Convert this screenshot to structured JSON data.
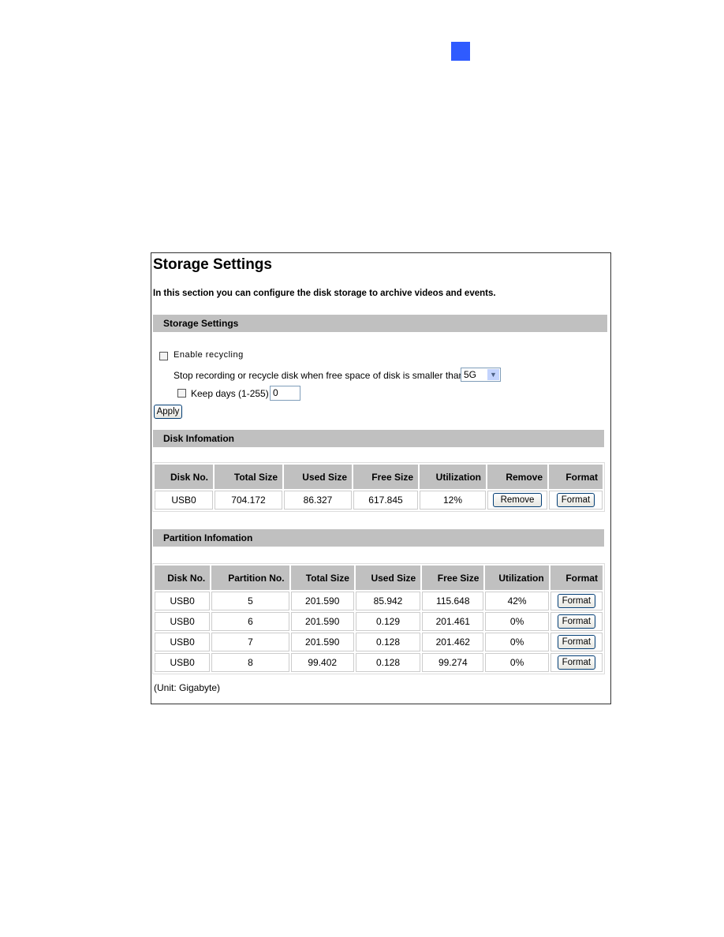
{
  "page_marker_color": "#2f5bff",
  "title": "Storage Settings",
  "intro": "In this section you can configure the disk storage to archive videos and events.",
  "storage": {
    "section_title": "Storage Settings",
    "enable_recycling": {
      "label": "Enable recycling",
      "checked": false
    },
    "threshold_label": "Stop recording or recycle disk when free space of disk is smaller than",
    "threshold_value": "5G",
    "keep_days": {
      "label": "Keep days (1-255)",
      "checked": false,
      "value": "0"
    },
    "apply_label": "Apply"
  },
  "disk": {
    "section_title": "Disk Infomation",
    "headers": [
      "Disk No.",
      "Total Size",
      "Used Size",
      "Free Size",
      "Utilization",
      "Remove",
      "Format"
    ],
    "rows": [
      [
        "USB0",
        "704.172",
        "86.327",
        "617.845",
        "12%",
        "Remove",
        "Format"
      ]
    ]
  },
  "partition": {
    "section_title": "Partition Infomation",
    "headers": [
      "Disk No.",
      "Partition No.",
      "Total Size",
      "Used Size",
      "Free Size",
      "Utilization",
      "Format"
    ],
    "rows": [
      [
        "USB0",
        "5",
        "201.590",
        "85.942",
        "115.648",
        "42%",
        "Format"
      ],
      [
        "USB0",
        "6",
        "201.590",
        "0.129",
        "201.461",
        "0%",
        "Format"
      ],
      [
        "USB0",
        "7",
        "201.590",
        "0.128",
        "201.462",
        "0%",
        "Format"
      ],
      [
        "USB0",
        "8",
        "99.402",
        "0.128",
        "99.274",
        "0%",
        "Format"
      ]
    ]
  },
  "unit_note": "(Unit: Gigabyte)"
}
